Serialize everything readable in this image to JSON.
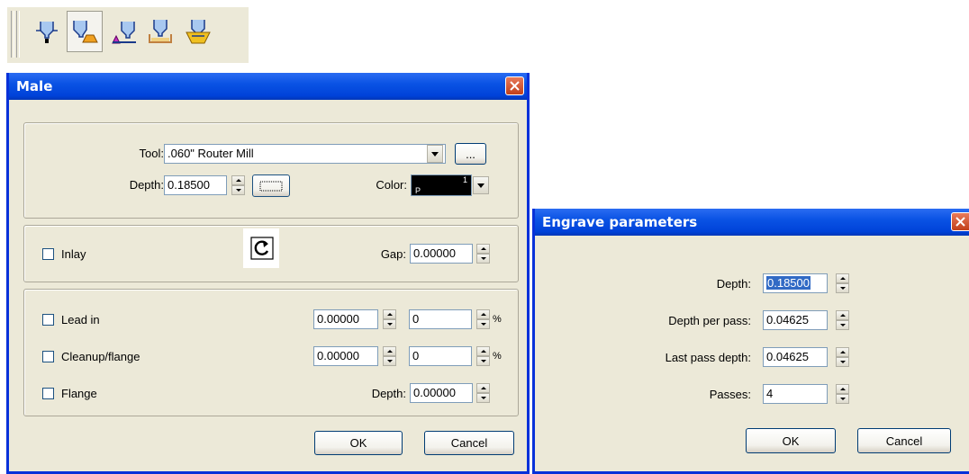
{
  "toolbar": {
    "buttons": [
      {
        "icon": "engrave-tool-icon"
      },
      {
        "icon": "male-inlay-tool-icon"
      },
      {
        "icon": "female-inlay-tool-icon"
      },
      {
        "icon": "pocket-tool-icon"
      },
      {
        "icon": "pocket-flange-tool-icon"
      }
    ]
  },
  "male_dialog": {
    "title": "Male",
    "tool_label": "Tool:",
    "tool_value": ".060\" Router Mill",
    "browse_label": "...",
    "depth_label": "Depth:",
    "depth_value": "0.18500",
    "color_label": "Color:",
    "color_swatch_text_a": "P",
    "color_swatch_text_b": "1",
    "inlay_label": "Inlay",
    "gap_label": "Gap:",
    "gap_value": "0.00000",
    "lead_in_label": "Lead in",
    "lead_in_value": "0.00000",
    "lead_in_percent": "0",
    "cleanup_label": "Cleanup/flange",
    "cleanup_value": "0.00000",
    "cleanup_percent": "0",
    "percent_sign": "%",
    "flange_label": "Flange",
    "flange_depth_label": "Depth:",
    "flange_depth_value": "0.00000",
    "ok_label": "OK",
    "cancel_label": "Cancel"
  },
  "engrave_dialog": {
    "title": "Engrave parameters",
    "depth_label": "Depth:",
    "depth_value": "0.18500",
    "depth_per_pass_label": "Depth per pass:",
    "depth_per_pass_value": "0.04625",
    "last_pass_label": "Last pass depth:",
    "last_pass_value": "0.04625",
    "passes_label": "Passes:",
    "passes_value": "4",
    "ok_label": "OK",
    "cancel_label": "Cancel"
  },
  "colors": {
    "title_bar": "#0a53e4",
    "dialog_bg": "#ece9d8",
    "selection": "#316ac5"
  }
}
